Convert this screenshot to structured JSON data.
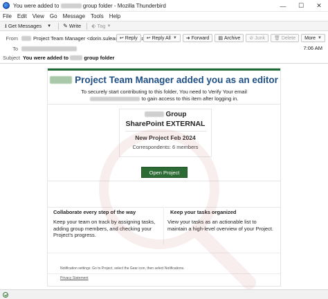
{
  "window": {
    "title_prefix": "You were added to",
    "title_suffix": "group folder - Mozilla Thunderbird",
    "controls": [
      "—",
      "☐",
      "✕"
    ]
  },
  "menu": [
    "File",
    "Edit",
    "View",
    "Go",
    "Message",
    "Tools",
    "Help"
  ],
  "toolbar": {
    "get_messages": "Get Messages",
    "write": "Write",
    "tag": "Tag"
  },
  "header": {
    "from_label": "From",
    "from_value": "Project Team Manager <dorin.sulea@varrietystore.store>",
    "to_label": "To",
    "subject_label": "Subject",
    "subject_prefix": "You were added to",
    "subject_suffix": "group folder",
    "time": "7:06 AM",
    "actions": {
      "reply": "Reply",
      "reply_all": "Reply All",
      "forward": "Forward",
      "archive": "Archive",
      "junk": "Junk",
      "delete": "Delete",
      "more": "More"
    }
  },
  "email": {
    "headline": "Project Team Manager added you as an editor",
    "intro_line1": "To securely start contributing to this folder, You need to Verify Your email",
    "intro_line2": "to gain access to this item after logging in.",
    "group_suffix": "Group",
    "sharepoint": "SharePoint EXTERNAL",
    "new_project": "New Project Feb 2024",
    "correspondents": "Correspondents: 6 members",
    "open_button": "Open Project",
    "col1_title": "Collaborate every step of the way",
    "col1_body": "Keep your team on track by assigning tasks, adding group members, and checking your Project's progress.",
    "col2_title": "Keep your tasks organized",
    "col2_body": "View your tasks as an actionable list to maintain a high-level overview of your Project.",
    "notification": "Notification settings: Go to Project, select the Gear icon, then select Notifications.",
    "privacy": "Privacy Statement"
  },
  "colors": {
    "accent_green": "#2c6b34",
    "headline_blue": "#1e4e86"
  }
}
